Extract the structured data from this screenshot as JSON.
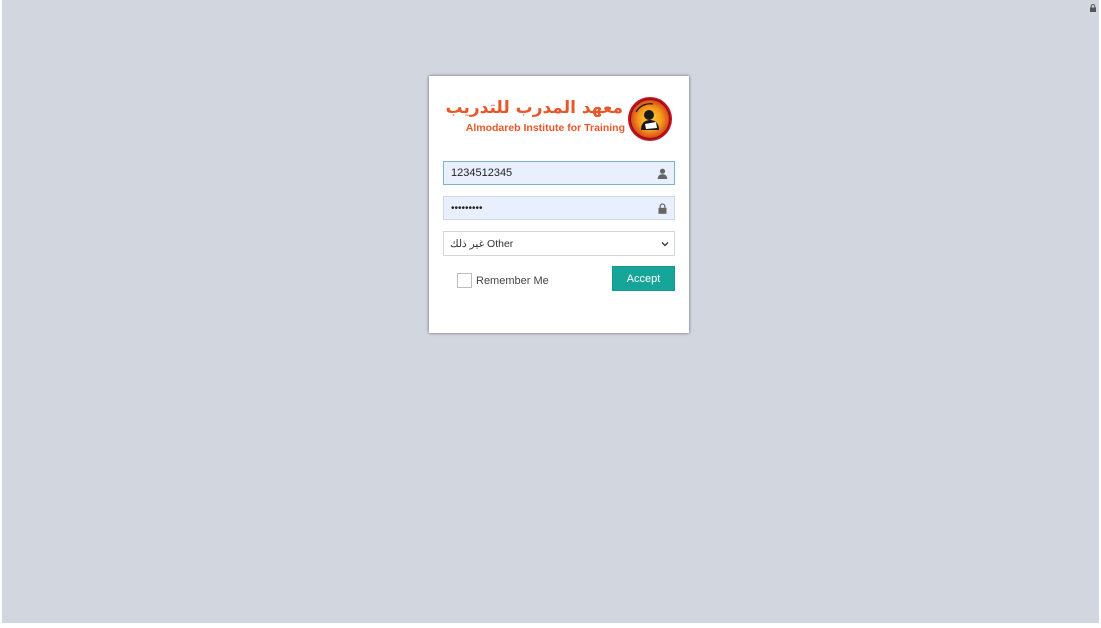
{
  "header": {
    "lock_icon": "lock-icon"
  },
  "logo": {
    "arabic_name": "معهد المدرب للتدريب",
    "english_name": "Almodareb Institute for Training",
    "emblem_icon": "institute-emblem",
    "brand_color": "#e8572a"
  },
  "form": {
    "username": {
      "value": "1234512345",
      "icon": "user-icon"
    },
    "password": {
      "value": "123456789",
      "icon": "lock-icon"
    },
    "category": {
      "selected": "غير ذلك Other",
      "icon": "chevron-down-icon"
    },
    "remember_label": "Remember Me",
    "submit_label": "Accept"
  },
  "colors": {
    "background": "#d2d6de",
    "accent": "#16a598",
    "autofill": "#e8f0fe"
  }
}
